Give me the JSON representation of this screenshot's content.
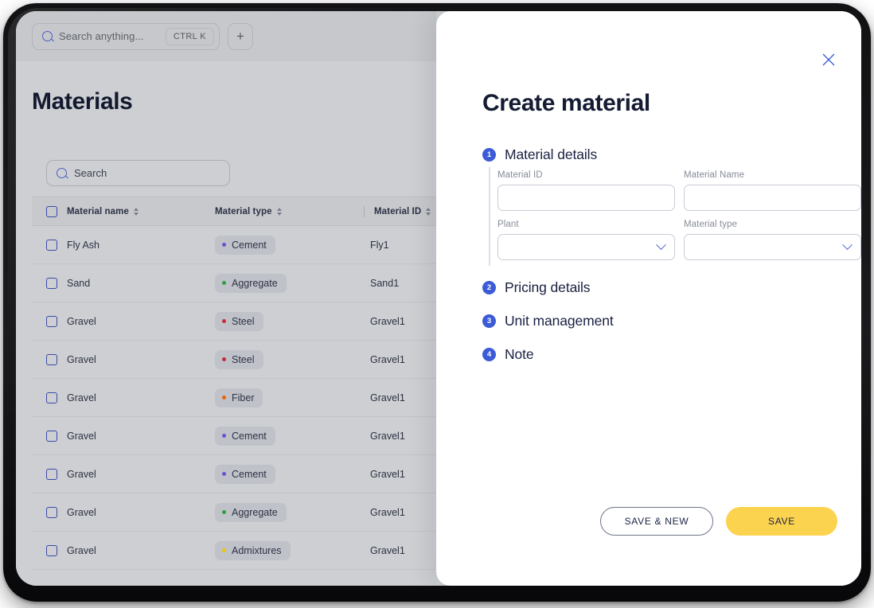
{
  "device": {
    "frame_color": "#14141a"
  },
  "topbar": {
    "global_search": {
      "placeholder": "Search anything...",
      "icon": "search-icon",
      "shortcut": "CTRL K"
    },
    "add_button": {
      "label": "+",
      "icon": "plus-icon"
    }
  },
  "page": {
    "title": "Materials"
  },
  "table": {
    "search": {
      "placeholder": "Search",
      "icon": "search-icon"
    },
    "columns": [
      {
        "key": "check",
        "label": "",
        "sortable": false
      },
      {
        "key": "name",
        "label": "Material name",
        "sortable": true
      },
      {
        "key": "type",
        "label": "Material type",
        "sortable": true
      },
      {
        "key": "id",
        "label": "Material ID",
        "sortable": true
      }
    ],
    "type_colors": {
      "Cement": "#6d4fd0",
      "Aggregate": "#2f9e44",
      "Steel": "#c92a3d",
      "Fiber": "#e8630a",
      "Admixtures": "#edc20b"
    },
    "rows": [
      {
        "name": "Fly Ash",
        "type": "Cement",
        "id": "Fly1"
      },
      {
        "name": "Sand",
        "type": "Aggregate",
        "id": "Sand1"
      },
      {
        "name": "Gravel",
        "type": "Steel",
        "id": "Gravel1"
      },
      {
        "name": "Gravel",
        "type": "Steel",
        "id": "Gravel1"
      },
      {
        "name": "Gravel",
        "type": "Fiber",
        "id": "Gravel1"
      },
      {
        "name": "Gravel",
        "type": "Cement",
        "id": "Gravel1"
      },
      {
        "name": "Gravel",
        "type": "Cement",
        "id": "Gravel1"
      },
      {
        "name": "Gravel",
        "type": "Aggregate",
        "id": "Gravel1"
      },
      {
        "name": "Gravel",
        "type": "Admixtures",
        "id": "Gravel1"
      }
    ]
  },
  "modal": {
    "title": "Create material",
    "close_icon": "close-icon",
    "accent_color": "#3c5bd6",
    "steps": [
      {
        "number": "1",
        "label": "Material details"
      },
      {
        "number": "2",
        "label": "Pricing details"
      },
      {
        "number": "3",
        "label": "Unit management"
      },
      {
        "number": "4",
        "label": "Note"
      }
    ],
    "fields": [
      {
        "label": "Material ID",
        "value": "",
        "control": "input"
      },
      {
        "label": "Material Name",
        "value": "",
        "control": "input"
      },
      {
        "label": "Plant",
        "value": "",
        "control": "select"
      },
      {
        "label": "Material type",
        "value": "",
        "control": "select"
      }
    ],
    "actions": {
      "save_new_label": "SAVE & NEW",
      "save_label": "SAVE",
      "save_color": "#fcd34f"
    }
  }
}
